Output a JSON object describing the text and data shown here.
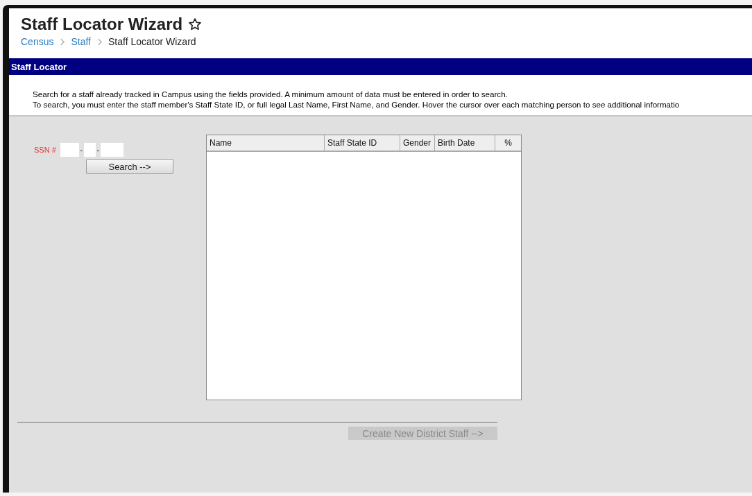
{
  "page": {
    "title": "Staff Locator Wizard",
    "favorite": false
  },
  "breadcrumb": [
    {
      "label": "Census",
      "link": true
    },
    {
      "label": "Staff",
      "link": true
    },
    {
      "label": "Staff Locator Wizard",
      "link": false
    }
  ],
  "panel": {
    "title": "Staff Locator"
  },
  "instructions": [
    "Search for a staff already tracked in Campus using the fields provided. A minimum amount of data must be entered in order to search.",
    "To search, you must enter the staff member's Staff State ID, or full legal Last Name, First Name, and Gender. Hover the cursor over each matching person to see additional informatio"
  ],
  "ssn": {
    "label": "SSN #",
    "separators": [
      "-",
      "-"
    ]
  },
  "search_button": {
    "label": "Search -->",
    "disabled": false
  },
  "results": {
    "columns": [
      "Name",
      "Staff State ID",
      "Gender",
      "Birth Date",
      "%"
    ]
  },
  "create_button": {
    "label": "Create New District Staff -->",
    "disabled": true
  }
}
